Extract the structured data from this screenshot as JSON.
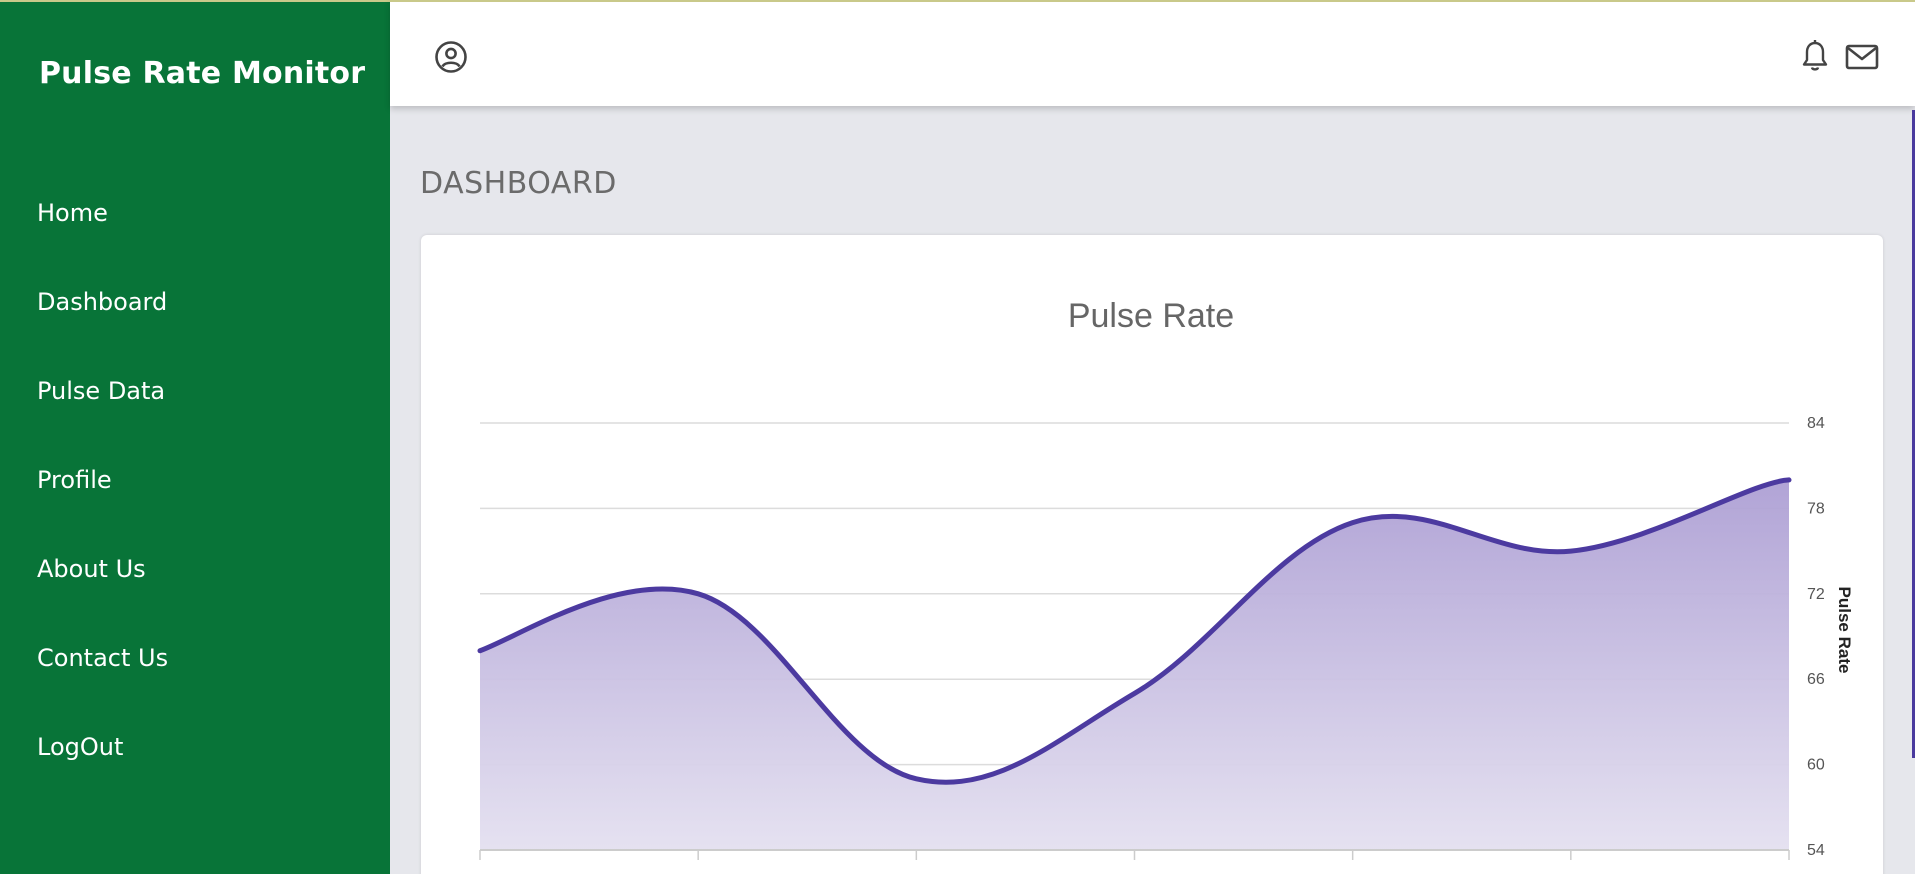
{
  "app": {
    "title": "Pulse Rate Monitor"
  },
  "sidebar": {
    "items": [
      {
        "label": "Home"
      },
      {
        "label": "Dashboard"
      },
      {
        "label": "Pulse Data"
      },
      {
        "label": "Profile"
      },
      {
        "label": "About Us"
      },
      {
        "label": "Contact Us"
      },
      {
        "label": "LogOut"
      }
    ]
  },
  "header": {
    "icons": [
      "user-circle-icon",
      "bell-icon",
      "mail-icon"
    ]
  },
  "main": {
    "page_title": "DASHBOARD"
  },
  "colors": {
    "sidebar_bg": "#087438",
    "page_bg": "#e6e7ec",
    "series_line": "#4c3aa0",
    "series_fill": "#b3a6d8"
  },
  "chart_data": {
    "type": "area",
    "title": "Pulse Rate",
    "ylabel": "Pulse Rate",
    "xlabel": "",
    "y_axis_position": "right",
    "ylim": [
      54,
      84
    ],
    "yticks": [
      54,
      60,
      66,
      72,
      78,
      84
    ],
    "grid": true,
    "series": [
      {
        "values": [
          68,
          72,
          59,
          65,
          77,
          75,
          80
        ]
      }
    ]
  }
}
